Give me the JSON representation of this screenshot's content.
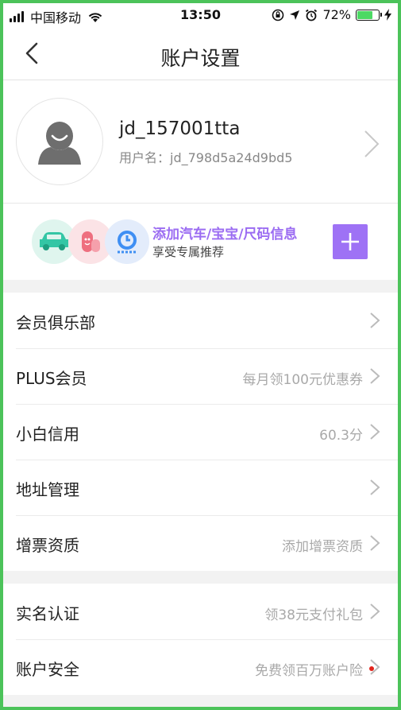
{
  "status_bar": {
    "carrier": "中国移动",
    "time": "13:50",
    "battery_percent": "72%",
    "battery_level": 0.72,
    "battery_color": "#4cd964"
  },
  "nav": {
    "title": "账户设置",
    "back_icon": "chevron-left-icon"
  },
  "profile": {
    "name": "jd_157001tta",
    "user_id_label": "用户名：jd_798d5a24d9bd5"
  },
  "promo": {
    "title": "添加汽车/宝宝/尺码信息",
    "subtitle": "享受专属推荐",
    "title_color": "#9b6cf2",
    "button_color": "#9e72f5",
    "icons": [
      "car-icon",
      "baby-icon",
      "size-tag-icon"
    ]
  },
  "groups": [
    [
      {
        "label": "会员俱乐部",
        "value": ""
      },
      {
        "label": "PLUS会员",
        "value": "每月领100元优惠券"
      },
      {
        "label": "小白信用",
        "value": "60.3分"
      },
      {
        "label": "地址管理",
        "value": ""
      },
      {
        "label": "增票资质",
        "value": "添加增票资质"
      }
    ],
    [
      {
        "label": "实名认证",
        "value": "领38元支付礼包"
      },
      {
        "label": "账户安全",
        "value": "免费领百万账户险"
      }
    ]
  ],
  "colors": {
    "frame_border": "#4cc35a",
    "badge_red": "#e2231a"
  }
}
